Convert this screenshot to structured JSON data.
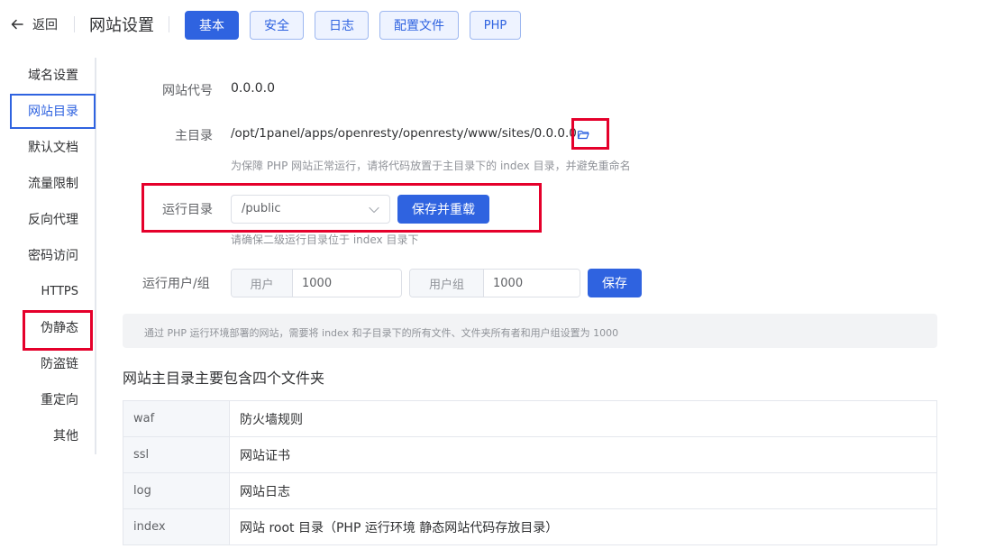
{
  "header": {
    "back_label": "返回",
    "title": "网站设置",
    "tabs": [
      {
        "label": "基本",
        "active": true
      },
      {
        "label": "安全",
        "active": false
      },
      {
        "label": "日志",
        "active": false
      },
      {
        "label": "配置文件",
        "active": false
      },
      {
        "label": "PHP",
        "active": false
      }
    ]
  },
  "sidebar": {
    "items": [
      {
        "label": "域名设置"
      },
      {
        "label": "网站目录",
        "active": true
      },
      {
        "label": "默认文档"
      },
      {
        "label": "流量限制"
      },
      {
        "label": "反向代理"
      },
      {
        "label": "密码访问"
      },
      {
        "label": "HTTPS"
      },
      {
        "label": "伪静态"
      },
      {
        "label": "防盗链"
      },
      {
        "label": "重定向"
      },
      {
        "label": "其他"
      }
    ]
  },
  "form": {
    "site_code_label": "网站代号",
    "site_code_value": "0.0.0.0",
    "root_label": "主目录",
    "root_value": "/opt/1panel/apps/openresty/openresty/www/sites/0.0.0.0",
    "root_hint": "为保障 PHP 网站正常运行，请将代码放置于主目录下的 index 目录，并避免重命名",
    "run_dir_label": "运行目录",
    "run_dir_value": "/public",
    "save_reload_label": "保存并重载",
    "run_dir_hint": "请确保二级运行目录位于 index 目录下",
    "user_group_label": "运行用户/组",
    "user_prefix": "用户",
    "user_value": "1000",
    "group_prefix": "用户组",
    "group_value": "1000",
    "save_label": "保存"
  },
  "info_text": "通过 PHP 运行环境部署的网站，需要将 index 和子目录下的所有文件、文件夹所有者和用户组设置为 1000",
  "section_title": "网站主目录主要包含四个文件夹",
  "folders": [
    {
      "name": "waf",
      "desc": "防火墙规则"
    },
    {
      "name": "ssl",
      "desc": "网站证书"
    },
    {
      "name": "log",
      "desc": "网站日志"
    },
    {
      "name": "index",
      "desc": "网站 root 目录（PHP 运行环境 静态网站代码存放目录）"
    }
  ],
  "colors": {
    "primary": "#2f63e0",
    "highlight_red": "#e5002b",
    "tab_plain_bg": "#eef3ff"
  },
  "icons": {
    "back": "arrow-left-icon",
    "folder": "folder-open-icon",
    "select": "chevron-down-icon"
  }
}
